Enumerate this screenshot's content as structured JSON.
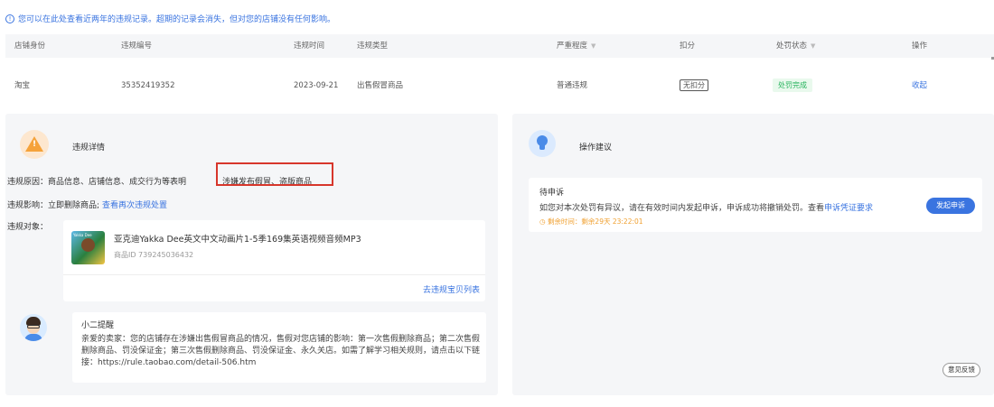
{
  "notice": {
    "icon": "info-icon",
    "icon_glyph": "!",
    "text": "您可以在此处查看近两年的违规记录。超期的记录会消失，但对您的店铺没有任何影响。"
  },
  "table": {
    "headers": [
      "店铺身份",
      "违规编号",
      "违规时间",
      "违规类型",
      "严重程度",
      "扣分",
      "处罚状态",
      "操作"
    ],
    "filter_glyph": "▼",
    "row": {
      "shop": "淘宝",
      "violation_id": "35352419352",
      "time": "2023-09-21",
      "type": "出售假冒商品",
      "severity": "普通违规",
      "points": "无扣分",
      "status": "处罚完成",
      "action": "收起"
    }
  },
  "details": {
    "title": "违规详情",
    "warning_glyph": "!",
    "reason_label": "违规原因：",
    "reason_text": "商品信息、店铺信息、成交行为等表明",
    "reason_highlight": "涉嫌发布假冒、盗版商品",
    "impact_label": "违规影响：",
    "impact_text": "立即删除商品;",
    "impact_link": "查看再次违规处置",
    "object_label": "违规对象：",
    "object": {
      "thumb_text": "Yakka Dee",
      "name": "亚克迪Yakka Dee英文中文动画片1-5季169集英语视频音频MP3",
      "id": "商品ID 739245036432",
      "link": "去违规宝贝列表"
    },
    "tip": {
      "title": "小二提醒",
      "body": "亲爱的卖家：您的店铺存在涉嫌出售假冒商品的情况，售假对您店铺的影响：第一次售假删除商品；第二次售假删除商品、罚没保证金；第三次售假删除商品、罚没保证金、永久关店。如需了解学习相关规则，请点击以下链接：https://rule.taobao.com/detail-506.htm"
    }
  },
  "advice": {
    "title": "操作建议",
    "appeal": {
      "title": "待申诉",
      "desc_prefix": "如您对本次处罚有异议，请在有效时间内发起申诉，申诉成功将撤销处罚。查看",
      "desc_link": "申诉凭证要求",
      "remain": "剩余时间：剩余29天 23:22:01",
      "clock_glyph": "◷",
      "button": "发起申诉"
    },
    "feedback_button": "意见反馈"
  },
  "colors": {
    "link": "#3a74e0",
    "highlight": "#d7362b",
    "success": "#27b35d",
    "warning": "#f5a23a",
    "countdown": "#f0a030"
  }
}
